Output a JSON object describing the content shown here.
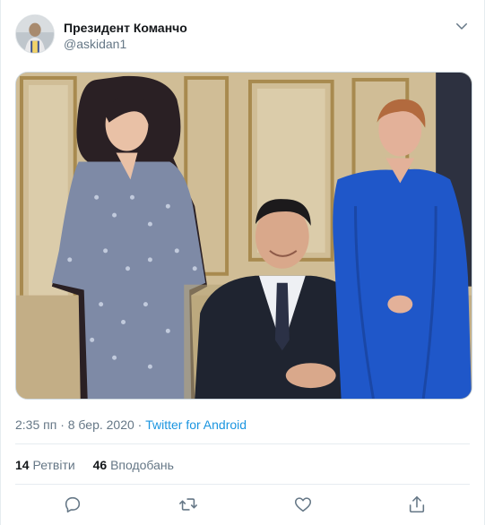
{
  "tweet": {
    "author_name": "Президент Команчо",
    "author_handle": "@askidan1",
    "timestamp": "2:35 пп · 8 бер. 2020",
    "separator": " · ",
    "source": "Twitter for Android",
    "retweets_count": "14",
    "retweets_label": "Ретвіти",
    "likes_count": "46",
    "likes_label": "Вподобань"
  },
  "icons": {
    "caret": "chevron-down-icon",
    "reply": "reply-icon",
    "retweet": "retweet-icon",
    "like": "heart-icon",
    "share": "share-icon"
  },
  "colors": {
    "link": "#1b95e0",
    "secondary_text": "#657786",
    "primary_text": "#14171a",
    "border": "#e6ecf0"
  }
}
